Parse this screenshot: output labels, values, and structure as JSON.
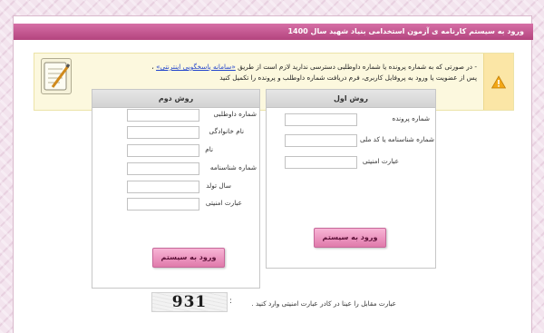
{
  "header": {
    "title": "ورود به سیستم کارنامه ی آزمون استخدامی بنیاد شهید سال 1400"
  },
  "notice": {
    "line1_prefix": "- در صورتی که به شماره پرونده یا شماره داوطلبی دسترسی ندارید لازم است از طریق ",
    "link_text": "«سامانه پاسخگویی اینترنتی»",
    "line1_suffix": " ،",
    "line2": "پس از عضویت یا ورود به پروفایل کاربری، فرم دریافت شماره داوطلب و پرونده را تکمیل کنید",
    "warning_icon": "warning-icon",
    "pad_icon": "notepad-icon"
  },
  "method1": {
    "title": "روش اول",
    "fields": [
      {
        "label": "شماره پرونده",
        "value": ""
      },
      {
        "label": "شماره شناسنامه یا کد ملی",
        "value": ""
      },
      {
        "label": "عبارت امنیتی",
        "value": ""
      }
    ],
    "submit_label": "ورود به سیستم"
  },
  "method2": {
    "title": "روش دوم",
    "fields": [
      {
        "label": "شماره داوطلبی",
        "value": ""
      },
      {
        "label": "نام خانوادگی",
        "value": ""
      },
      {
        "label": "نام",
        "value": ""
      },
      {
        "label": "شماره شناسنامه",
        "value": ""
      },
      {
        "label": "سال تولد",
        "value": ""
      },
      {
        "label": "عبارت امنیتی",
        "value": ""
      }
    ],
    "submit_label": "ورود به سیستم"
  },
  "captcha": {
    "code": "931",
    "separator": ":",
    "label": "عبارت مقابل را عینا در کادر عبارت امنیتی وارد کنید ."
  },
  "colors": {
    "brand": "#c0528b",
    "notice_bg": "#fcf8de",
    "button": "#e88fbb"
  }
}
